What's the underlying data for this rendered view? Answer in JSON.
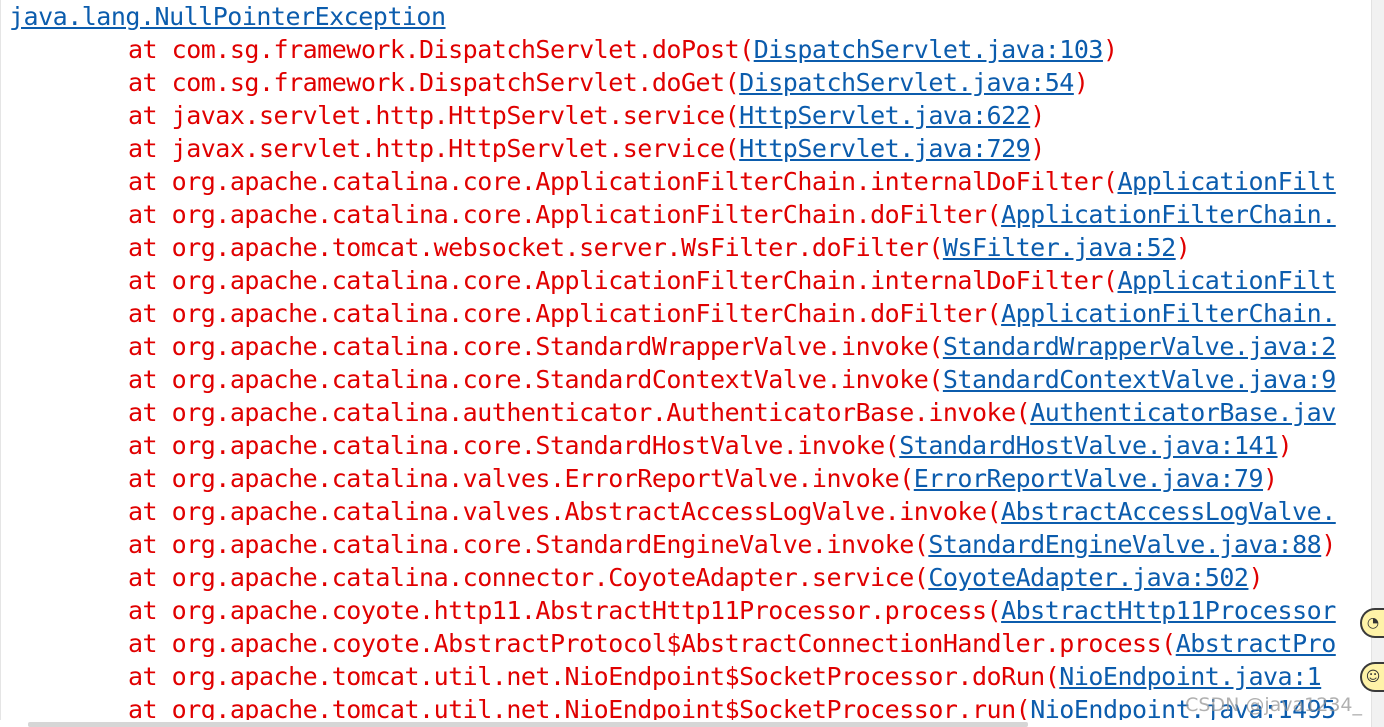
{
  "exception": "java.lang.NullPointerException",
  "frames": [
    {
      "prefix": "at com.sg.framework.DispatchServlet.doPost(",
      "link": "DispatchServlet.java:103",
      "suffix": ")"
    },
    {
      "prefix": "at com.sg.framework.DispatchServlet.doGet(",
      "link": "DispatchServlet.java:54",
      "suffix": ")"
    },
    {
      "prefix": "at javax.servlet.http.HttpServlet.service(",
      "link": "HttpServlet.java:622",
      "suffix": ")"
    },
    {
      "prefix": "at javax.servlet.http.HttpServlet.service(",
      "link": "HttpServlet.java:729",
      "suffix": ")"
    },
    {
      "prefix": "at org.apache.catalina.core.ApplicationFilterChain.internalDoFilter(",
      "link": "ApplicationFilt",
      "suffix": ""
    },
    {
      "prefix": "at org.apache.catalina.core.ApplicationFilterChain.doFilter(",
      "link": "ApplicationFilterChain.",
      "suffix": ""
    },
    {
      "prefix": "at org.apache.tomcat.websocket.server.WsFilter.doFilter(",
      "link": "WsFilter.java:52",
      "suffix": ")"
    },
    {
      "prefix": "at org.apache.catalina.core.ApplicationFilterChain.internalDoFilter(",
      "link": "ApplicationFilt",
      "suffix": ""
    },
    {
      "prefix": "at org.apache.catalina.core.ApplicationFilterChain.doFilter(",
      "link": "ApplicationFilterChain.",
      "suffix": ""
    },
    {
      "prefix": "at org.apache.catalina.core.StandardWrapperValve.invoke(",
      "link": "StandardWrapperValve.java:2",
      "suffix": ""
    },
    {
      "prefix": "at org.apache.catalina.core.StandardContextValve.invoke(",
      "link": "StandardContextValve.java:9",
      "suffix": ""
    },
    {
      "prefix": "at org.apache.catalina.authenticator.AuthenticatorBase.invoke(",
      "link": "AuthenticatorBase.jav",
      "suffix": ""
    },
    {
      "prefix": "at org.apache.catalina.core.StandardHostValve.invoke(",
      "link": "StandardHostValve.java:141",
      "suffix": ")"
    },
    {
      "prefix": "at org.apache.catalina.valves.ErrorReportValve.invoke(",
      "link": "ErrorReportValve.java:79",
      "suffix": ")"
    },
    {
      "prefix": "at org.apache.catalina.valves.AbstractAccessLogValve.invoke(",
      "link": "AbstractAccessLogValve.",
      "suffix": ""
    },
    {
      "prefix": "at org.apache.catalina.core.StandardEngineValve.invoke(",
      "link": "StandardEngineValve.java:88",
      "suffix": ")"
    },
    {
      "prefix": "at org.apache.catalina.connector.CoyoteAdapter.service(",
      "link": "CoyoteAdapter.java:502",
      "suffix": ")"
    },
    {
      "prefix": "at org.apache.coyote.http11.AbstractHttp11Processor.process(",
      "link": "AbstractHttp11Processor",
      "suffix": ""
    },
    {
      "prefix": "at org.apache.coyote.AbstractProtocol$AbstractConnectionHandler.process(",
      "link": "AbstractPro",
      "suffix": ""
    },
    {
      "prefix": "at org.apache.tomcat.util.net.NioEndpoint$SocketProcessor.doRun(",
      "link": "NioEndpoint.java:1",
      "suffix": ""
    },
    {
      "prefix": "at org.apache.tomcat.util.net.NioEndpoint$SocketProcessor.run(",
      "link": "NioEndpoint.java:1495",
      "suffix": ""
    }
  ],
  "watermark": "CSDN @java1234_",
  "colors": {
    "frame_text": "#e00000",
    "link": "#0b5cad",
    "background": "#ffffff"
  },
  "widgets": {
    "assist_top_icon": "chat-bubble-icon",
    "assist_bottom_icon": "smile-icon",
    "assist_top_glyph": "◔",
    "assist_bottom_glyph": "☺"
  }
}
